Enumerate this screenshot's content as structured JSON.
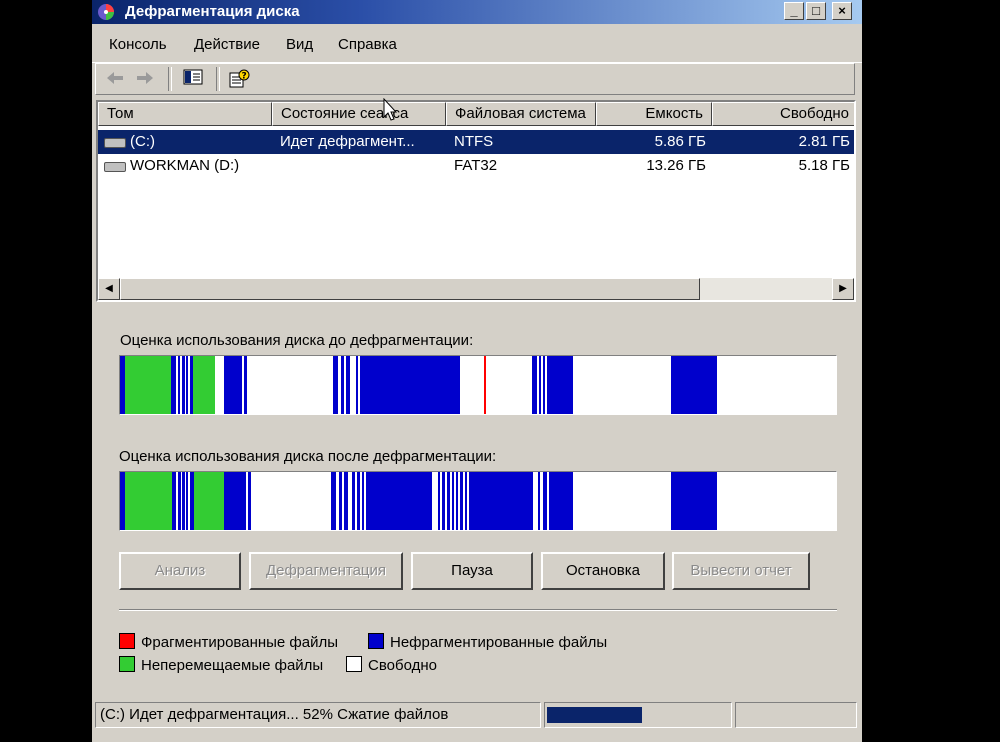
{
  "window": {
    "title": "Дефрагментация диска",
    "controls": {
      "minimize": "_",
      "maximize": "□",
      "close": "×"
    }
  },
  "menu": {
    "items": [
      "Консоль",
      "Действие",
      "Вид",
      "Справка"
    ]
  },
  "toolbar": {
    "icons": [
      "back-arrow-icon",
      "forward-arrow-icon",
      "show-hide-tree-icon",
      "help-icon"
    ]
  },
  "volumes": {
    "columns": [
      "Том",
      "Состояние сеанса",
      "Файловая система",
      "Емкость",
      "Свободно"
    ],
    "rows": [
      {
        "name": "(C:)",
        "status": "Идет дефрагмент...",
        "fs": "NTFS",
        "capacity": "5.86 ГБ",
        "free": "2.81 ГБ",
        "selected": true
      },
      {
        "name": "WORKMAN (D:)",
        "status": "",
        "fs": "FAT32",
        "capacity": "13.26 ГБ",
        "free": "5.18 ГБ",
        "selected": false
      }
    ]
  },
  "analysis": {
    "before_label": "Оценка использования диска до дефрагментации:",
    "after_label": "Оценка использования диска после дефрагментации:"
  },
  "buttons": {
    "analyze": "Анализ",
    "defragment": "Дефрагментация",
    "pause": "Пауза",
    "stop": "Остановка",
    "report": "Вывести отчет"
  },
  "legend": {
    "fragmented": "Фрагментированные файлы",
    "contiguous": "Нефрагментированные файлы",
    "unmovable": "Неперемещаемые файлы",
    "free": "Свободно"
  },
  "colors": {
    "fragmented": "#ff0000",
    "contiguous": "#0000cc",
    "unmovable": "#33cc33",
    "free": "#ffffff",
    "selection": "#0a246a"
  },
  "status": {
    "text": "(C:) Идет дефрагментация... 52%  Сжатие файлов",
    "progress": 0.52
  }
}
